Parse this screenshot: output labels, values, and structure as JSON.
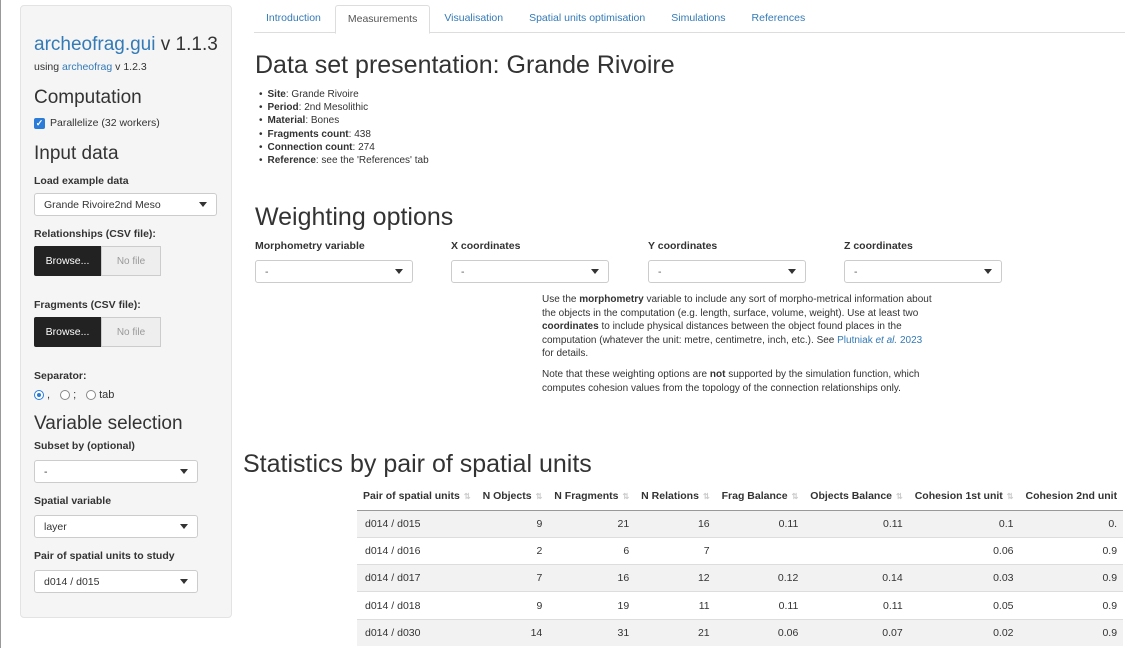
{
  "sidebar": {
    "app_name": "archeofrag.gui",
    "app_version": " v 1.1.3",
    "using_prefix": "using ",
    "using_link": "archeofrag",
    "using_version": " v 1.2.3",
    "computation_title": "Computation",
    "parallelize_label": "Parallelize (32 workers)",
    "input_title": "Input data",
    "load_example_label": "Load example data",
    "load_example_value": "Grande Rivoire2nd Meso",
    "relationships_label": "Relationships (CSV file):",
    "fragments_label": "Fragments (CSV file):",
    "browse_label": "Browse...",
    "nofile_label": "No file",
    "separator_label": "Separator:",
    "sep_comma": ",",
    "sep_semicolon": ";",
    "sep_tab": "tab",
    "variable_title": "Variable selection",
    "subset_label": "Subset by (optional)",
    "subset_value": "-",
    "spatial_label": "Spatial variable",
    "spatial_value": "layer",
    "pair_label": "Pair of spatial units to study",
    "pair_value": "d014 / d015"
  },
  "tabs": [
    "Introduction",
    "Measurements",
    "Visualisation",
    "Spatial units optimisation",
    "Simulations",
    "References"
  ],
  "main": {
    "dataset_title": "Data set presentation: Grande Rivoire",
    "bullets": [
      {
        "key": "Site",
        "value": ": Grande Rivoire"
      },
      {
        "key": "Period",
        "value": ": 2nd Mesolithic"
      },
      {
        "key": "Material",
        "value": ": Bones"
      },
      {
        "key": "Fragments count",
        "value": ": 438"
      },
      {
        "key": "Connection count",
        "value": ": 274"
      },
      {
        "key": "Reference",
        "value": ": see the 'References' tab"
      }
    ],
    "weighting_title": "Weighting options",
    "weight_fields": [
      {
        "label": "Morphometry variable",
        "value": "-"
      },
      {
        "label": "X coordinates",
        "value": "-"
      },
      {
        "label": "Y coordinates",
        "value": "-"
      },
      {
        "label": "Z coordinates",
        "value": "-"
      }
    ],
    "note1_a": "Use the ",
    "note1_b": "morphometry",
    "note1_c": " variable to include any sort of morpho-metrical information about the objects in the computation (e.g. length, surface, volume, weight). Use at least two ",
    "note1_d": "coordinates",
    "note1_e": " to include physical distances between the object found places in the computation (whatever the unit: metre, centimetre, inch, etc.). See ",
    "note1_link_a": "Plutniak ",
    "note1_link_b": "et al.",
    "note1_link_c": " 2023",
    "note1_f": " for details.",
    "note2_a": "Note that these weighting options are ",
    "note2_b": "not",
    "note2_c": " supported by the simulation function, which computes cohesion values from the topology of the connection relationships only.",
    "stats_title": "Statistics by pair of spatial units"
  },
  "table": {
    "headers": [
      "Pair of spatial units",
      "N Objects",
      "N Fragments",
      "N Relations",
      "Frag Balance",
      "Objects Balance",
      "Cohesion 1st unit",
      "Cohesion 2nd unit"
    ],
    "rows": [
      [
        "d014 / d015",
        "9",
        "21",
        "16",
        "0.11",
        "0.11",
        "0.1",
        "0."
      ],
      [
        "d014 / d016",
        "2",
        "6",
        "7",
        "",
        "",
        "0.06",
        "0.9"
      ],
      [
        "d014 / d017",
        "7",
        "16",
        "12",
        "0.12",
        "0.14",
        "0.03",
        "0.9"
      ],
      [
        "d014 / d018",
        "9",
        "19",
        "11",
        "0.11",
        "0.11",
        "0.05",
        "0.9"
      ],
      [
        "d014 / d030",
        "14",
        "31",
        "21",
        "0.06",
        "0.07",
        "0.02",
        "0.9"
      ]
    ]
  },
  "colors": {
    "link": "#337ab7",
    "checkbox": "#2b7bd8"
  }
}
